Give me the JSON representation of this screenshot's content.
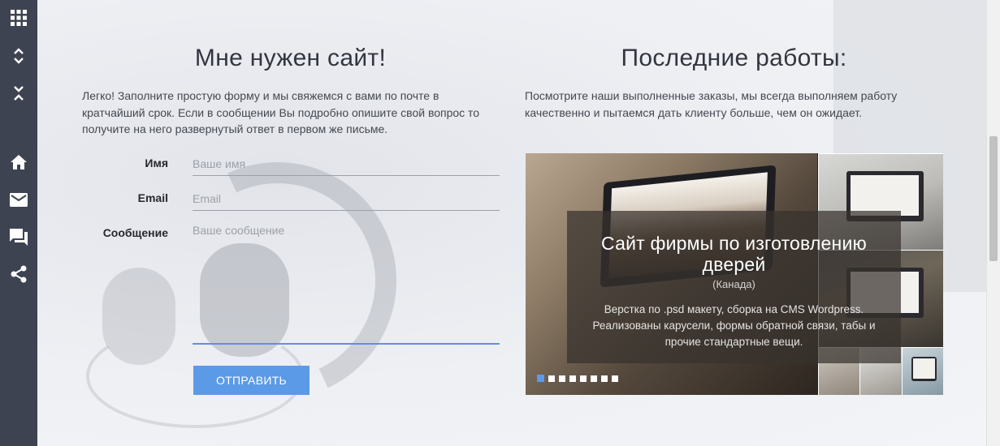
{
  "sidebar": {
    "icons": [
      "apps-grid-icon",
      "expand-icon",
      "collapse-icon",
      "home-icon",
      "mail-icon",
      "chat-icon",
      "share-icon"
    ]
  },
  "contact": {
    "title": "Мне нужен сайт!",
    "description": "Легко! Заполните простую форму и мы свяжемся с вами по почте в кратчайший срок. Если в сообщении Вы подробно опишите свой вопрос то получите на него развернутый ответ в первом же письме.",
    "fields": {
      "name_label": "Имя",
      "name_placeholder": "Ваше имя",
      "name_value": "",
      "email_label": "Email",
      "email_placeholder": "Email",
      "email_value": "",
      "message_label": "Сообщение",
      "message_placeholder": "Ваше сообщение",
      "message_value": ""
    },
    "submit_label": "ОТПРАВИТЬ"
  },
  "portfolio": {
    "title": "Последние работы:",
    "description": "Посмотрите наши выполненные заказы, мы всегда выполняем работу качественно и пытаемся дать клиенту больше, чем он ожидает.",
    "slide": {
      "title": "Сайт фирмы по изготовлению дверей",
      "subtitle": "(Канада)",
      "description": "Верстка по .psd макету, сборка на CMS Wordpress. Реализованы карусели, формы обратной связи, табы и прочие стандартные вещи."
    },
    "slider": {
      "total_slides": 8,
      "active_index": 0
    }
  },
  "colors": {
    "sidebar_bg": "#3d4351",
    "accent": "#5b9ae6",
    "text": "#333640"
  }
}
